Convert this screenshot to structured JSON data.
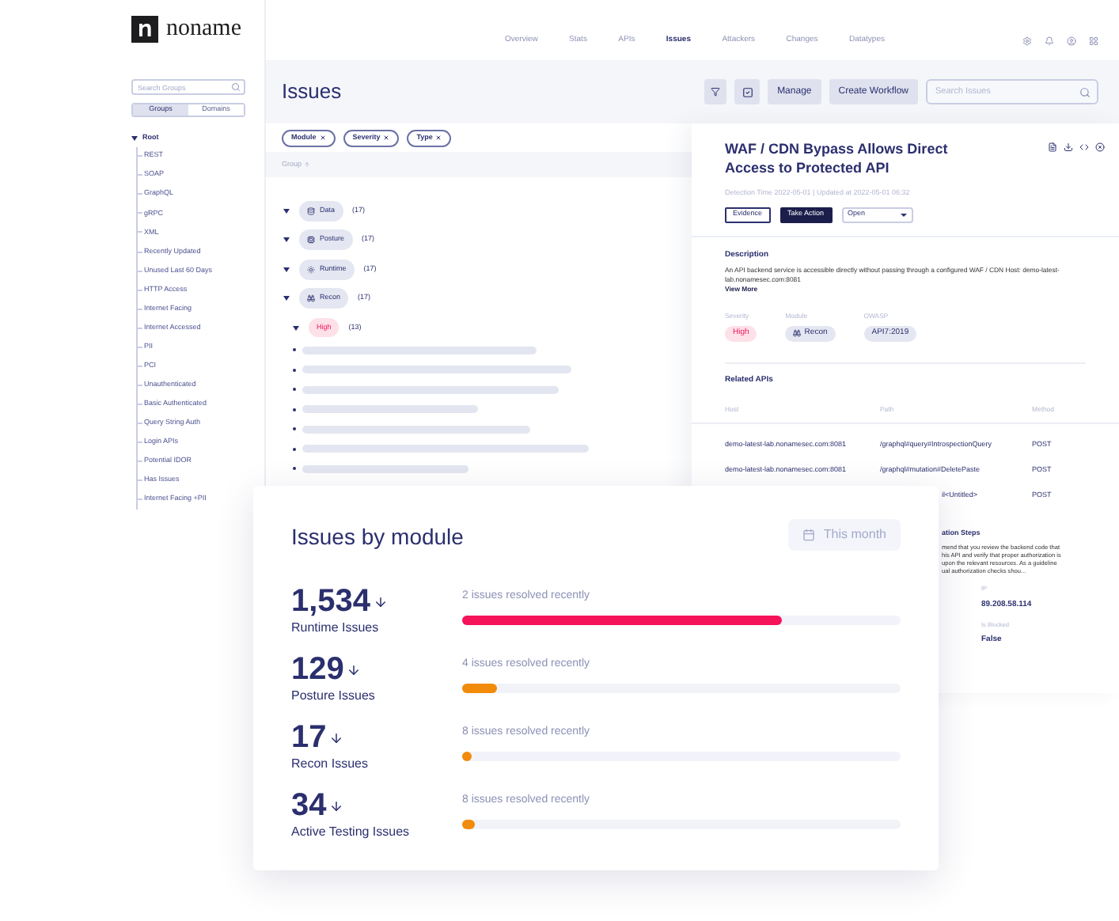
{
  "logo": {
    "text": "noname"
  },
  "sidebar": {
    "search": {
      "placeholder": "Search Groups"
    },
    "tabs": [
      {
        "label": "Groups",
        "selected": true
      },
      {
        "label": "Domains",
        "selected": false
      }
    ],
    "tree": {
      "label": "Root",
      "expanded": true,
      "children": [
        {
          "label": "REST"
        },
        {
          "label": "SOAP"
        },
        {
          "label": "GraphQL"
        },
        {
          "label": "gRPC"
        },
        {
          "label": "XML"
        },
        {
          "label": "Recently Updated"
        },
        {
          "label": "Unused Last 60 Days"
        },
        {
          "label": "HTTP Access"
        },
        {
          "label": "Internet Facing"
        },
        {
          "label": "Internet Accessed"
        },
        {
          "label": "PII"
        },
        {
          "label": "PCI"
        },
        {
          "label": "Unauthenticated"
        },
        {
          "label": "Basic Authenticated"
        },
        {
          "label": "Query String Auth"
        },
        {
          "label": "Login APIs"
        },
        {
          "label": "Potential IDOR"
        },
        {
          "label": "Has Issues"
        },
        {
          "label": "Internet Facing +PII"
        }
      ]
    }
  },
  "nav": {
    "items": [
      {
        "label": "Overview",
        "selected": false
      },
      {
        "label": "Stats",
        "selected": false
      },
      {
        "label": "APIs",
        "selected": false
      },
      {
        "label": "Issues",
        "selected": true
      },
      {
        "label": "Attackers",
        "selected": false
      },
      {
        "label": "Changes",
        "selected": false
      },
      {
        "label": "Datatypes",
        "selected": false
      }
    ]
  },
  "page": {
    "title": "Issues",
    "toolbar": {
      "checked": true,
      "buttons": [
        "Manage",
        "Create Workflow"
      ],
      "search": {
        "placeholder": "Search Issues"
      }
    },
    "filters": [
      "Module",
      "Severity",
      "Type"
    ],
    "group_header": "Group",
    "groups": [
      {
        "kind": "module",
        "label": "Data",
        "count": "(17)",
        "expanded": true
      },
      {
        "kind": "module",
        "label": "Posture",
        "count": "(17)",
        "expanded": true
      },
      {
        "kind": "module",
        "label": "Runtime",
        "count": "(17)",
        "expanded": true
      },
      {
        "kind": "module",
        "label": "Recon",
        "count": "(17)",
        "expanded": true
      },
      {
        "kind": "severity",
        "label": "High",
        "count": "(13)",
        "expanded": true
      }
    ]
  },
  "detail": {
    "title": "WAF / CDN Bypass Allows Direct Access to Protected API",
    "meta": "Detection Time 2022-05-01 | Updated at 2022-05-01 06:32",
    "buttons": [
      {
        "label": "Evidence",
        "kind": "outline"
      },
      {
        "label": "Take Action",
        "kind": "primary"
      }
    ],
    "status": {
      "value": "Open"
    },
    "description": {
      "heading": "Description",
      "text": "An API backend service is accessible directly without passing through a configured WAF / CDN Host: demo-latest-lab.nonamesec.com:8081",
      "link": "View More"
    },
    "fields": [
      {
        "label": "Severity",
        "value": "High",
        "kind": "severity"
      },
      {
        "label": "Module",
        "value": "Recon",
        "kind": "module"
      },
      {
        "label": "OWASP",
        "value": "API7:2019",
        "kind": "plain"
      }
    ],
    "related": {
      "heading": "Related APIs",
      "columns": [
        "Host",
        "Path",
        "Method"
      ],
      "rows": [
        {
          "host": "demo-latest-lab.nonamesec.com:8081",
          "path": "/graphql#query#IntrospectionQuery",
          "method": "POST"
        },
        {
          "host": "demo-latest-lab.nonamesec.com:8081",
          "path": "/graphql#mutation#DeletePaste",
          "method": "POST"
        },
        {
          "path": "il<Untitled>",
          "method": "POST"
        }
      ]
    },
    "remediation": {
      "heading": "ation Steps",
      "lines": [
        "mend that you review the backend code that",
        "his API and verify that proper authorization is",
        "upon the relevant resources. As a guideline",
        "ual authorization checks shou..."
      ]
    },
    "info": [
      {
        "label": "IP",
        "value": "89.208.58.114"
      },
      {
        "label": "Is Blocked",
        "value": "False"
      }
    ]
  },
  "card": {
    "title": "Issues by module",
    "period": "This month",
    "rows": [
      {
        "value": "1,534",
        "label": "Runtime Issues",
        "note": "2 issues resolved recently",
        "level": 0.73,
        "color": "#f5135a"
      },
      {
        "value": "129",
        "label": "Posture Issues",
        "note": "4 issues resolved recently",
        "level": 0.08,
        "color": "#f28a0c"
      },
      {
        "value": "17",
        "label": "Recon Issues",
        "note": "8 issues resolved recently",
        "level": 0.02,
        "color": "#f28a0c"
      },
      {
        "value": "34",
        "label": "Active Testing Issues",
        "note": "8 issues resolved recently",
        "level": 0.03,
        "color": "#f28a0c"
      }
    ]
  }
}
